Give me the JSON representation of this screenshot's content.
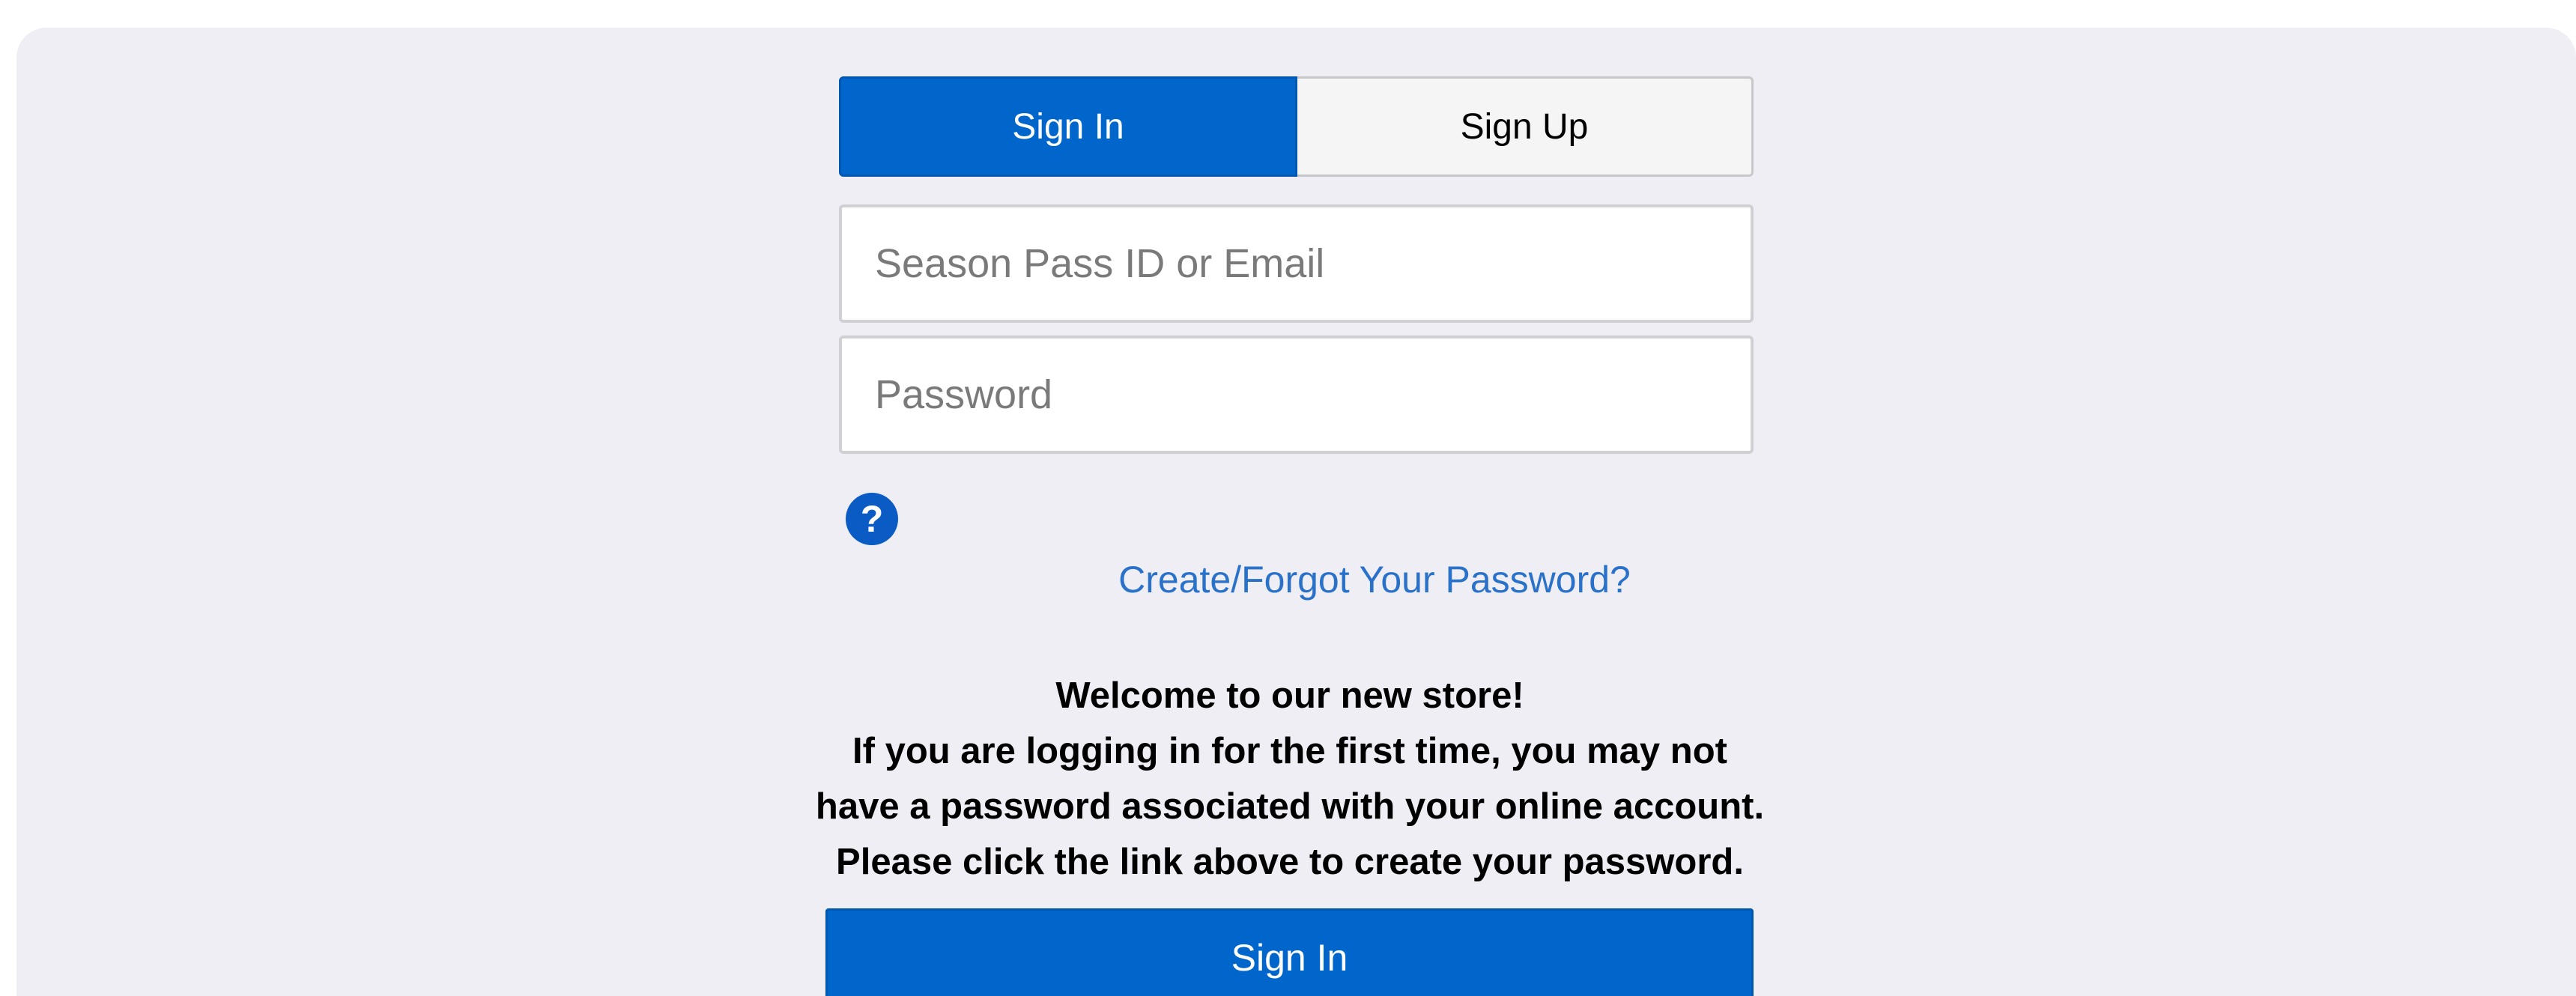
{
  "tabs": {
    "sign_in": "Sign In",
    "sign_up": "Sign Up"
  },
  "form": {
    "email_placeholder": "Season Pass ID or Email",
    "email_value": "",
    "password_placeholder": "Password",
    "password_value": "",
    "help_icon": "?",
    "forgot_link": "Create/Forgot Your Password?",
    "submit_label": "Sign In"
  },
  "notice": {
    "line1": "Welcome to our new store!",
    "line2": "If you are logging in for the first time, you may not",
    "line3": "have a password associated with your online account.",
    "line4": "Please click the link above to create your password."
  },
  "colors": {
    "accent": "#0066cc",
    "link": "#2a72c9",
    "background": "#efeef5"
  }
}
